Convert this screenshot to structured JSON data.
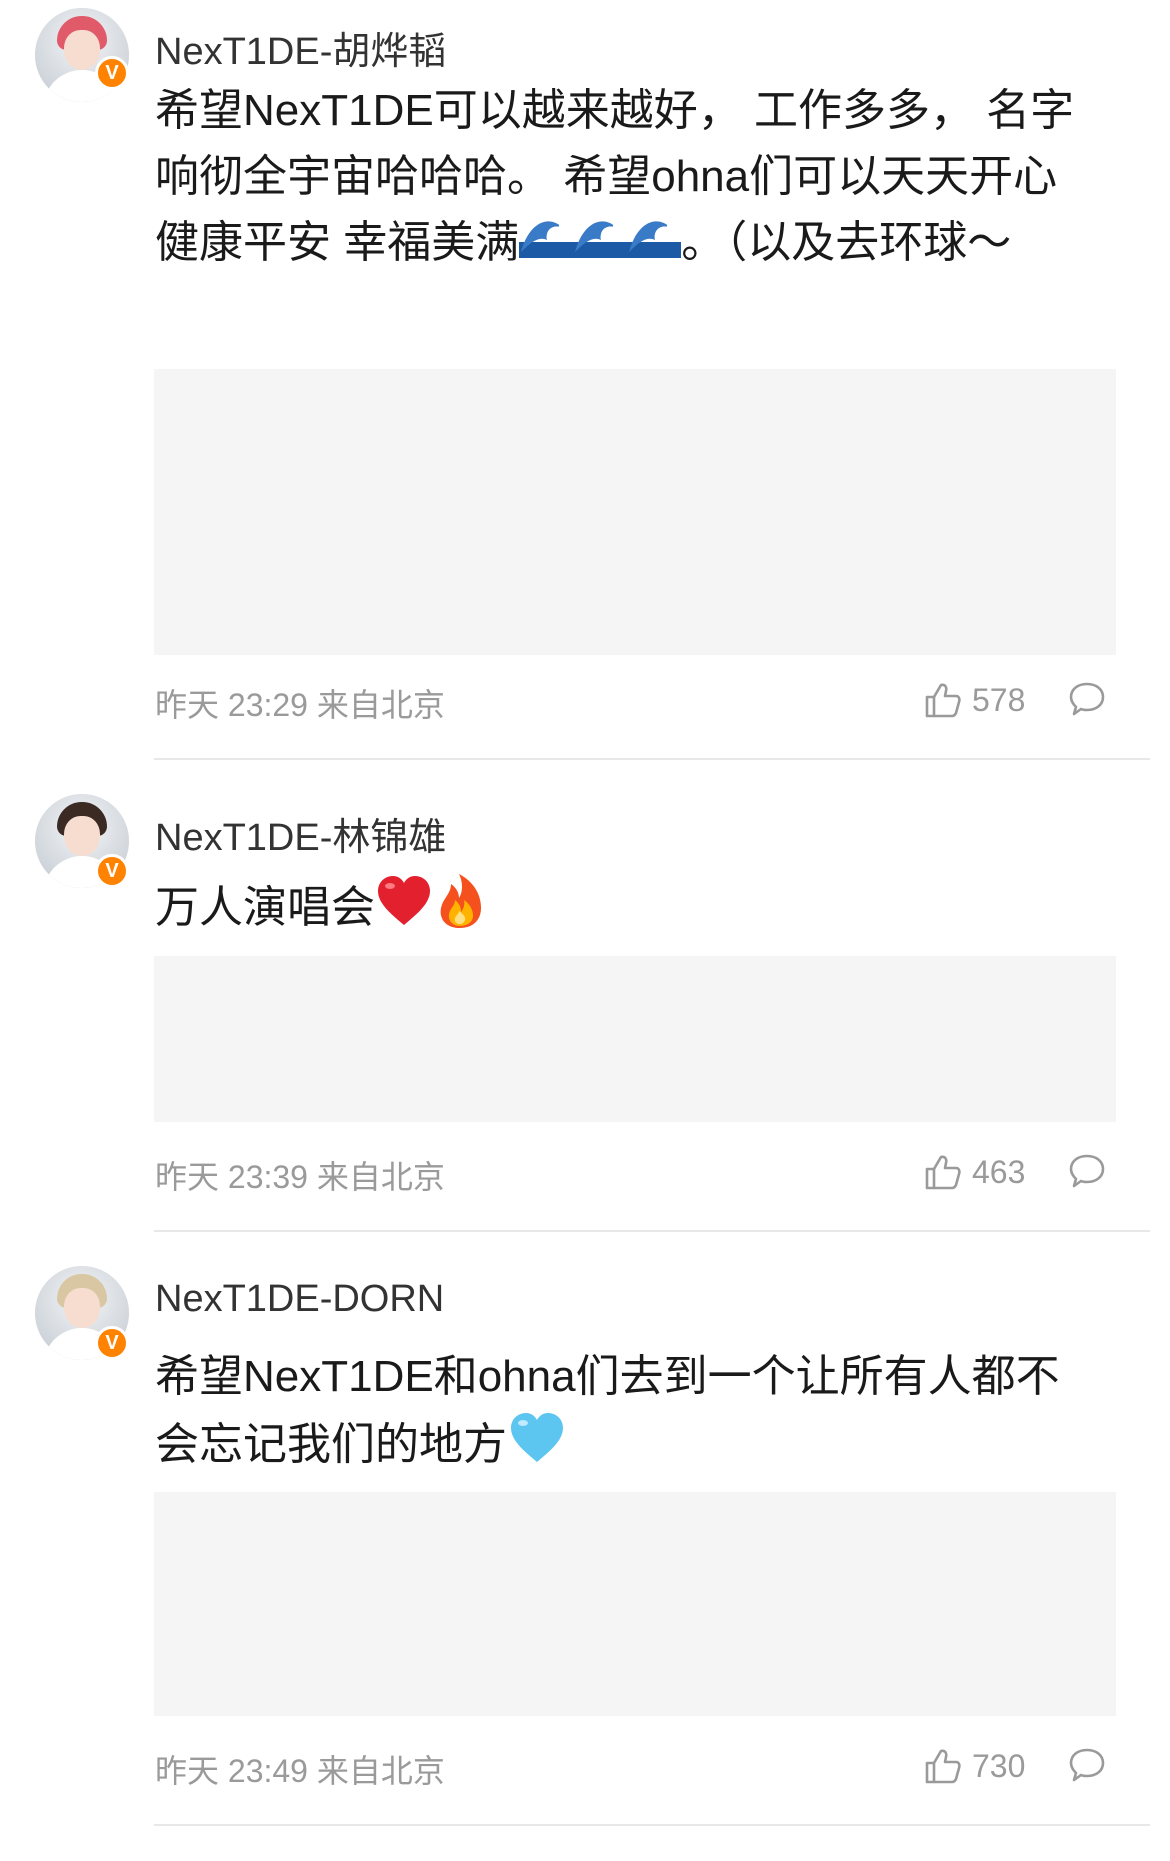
{
  "comments": [
    {
      "username": "NexT1DE-胡烨韬",
      "content": "希望NexT1DE可以越来越好， 工作多多， 名字响彻全宇宙哈哈哈。 希望ohna们可以天天开心 健康平安 幸福美满",
      "content_after_emoji": "。（以及去环球～",
      "emoji": [
        "wave",
        "wave",
        "wave"
      ],
      "time": "昨天 23:29",
      "location": "来自北京",
      "likes": "578",
      "hair_color": "#e05a6a"
    },
    {
      "username": "NexT1DE-林锦雄",
      "content": "万人演唱会",
      "emoji": [
        "red-heart",
        "fire"
      ],
      "time": "昨天 23:39",
      "location": "来自北京",
      "likes": "463",
      "hair_color": "#3b2a24"
    },
    {
      "username": "NexT1DE-DORN",
      "content": "希望NexT1DE和ohna们去到一个让所有人都不会忘记我们的地方",
      "emoji": [
        "light-blue-heart"
      ],
      "time": "昨天 23:49",
      "location": "来自北京",
      "likes": "730",
      "hair_color": "#d8c7a2"
    }
  ],
  "badge_letter": "V",
  "colors": {
    "verified_badge": "#ff8200",
    "meta_text": "#9a9a9a",
    "attachment_bg": "#f5f5f5"
  }
}
